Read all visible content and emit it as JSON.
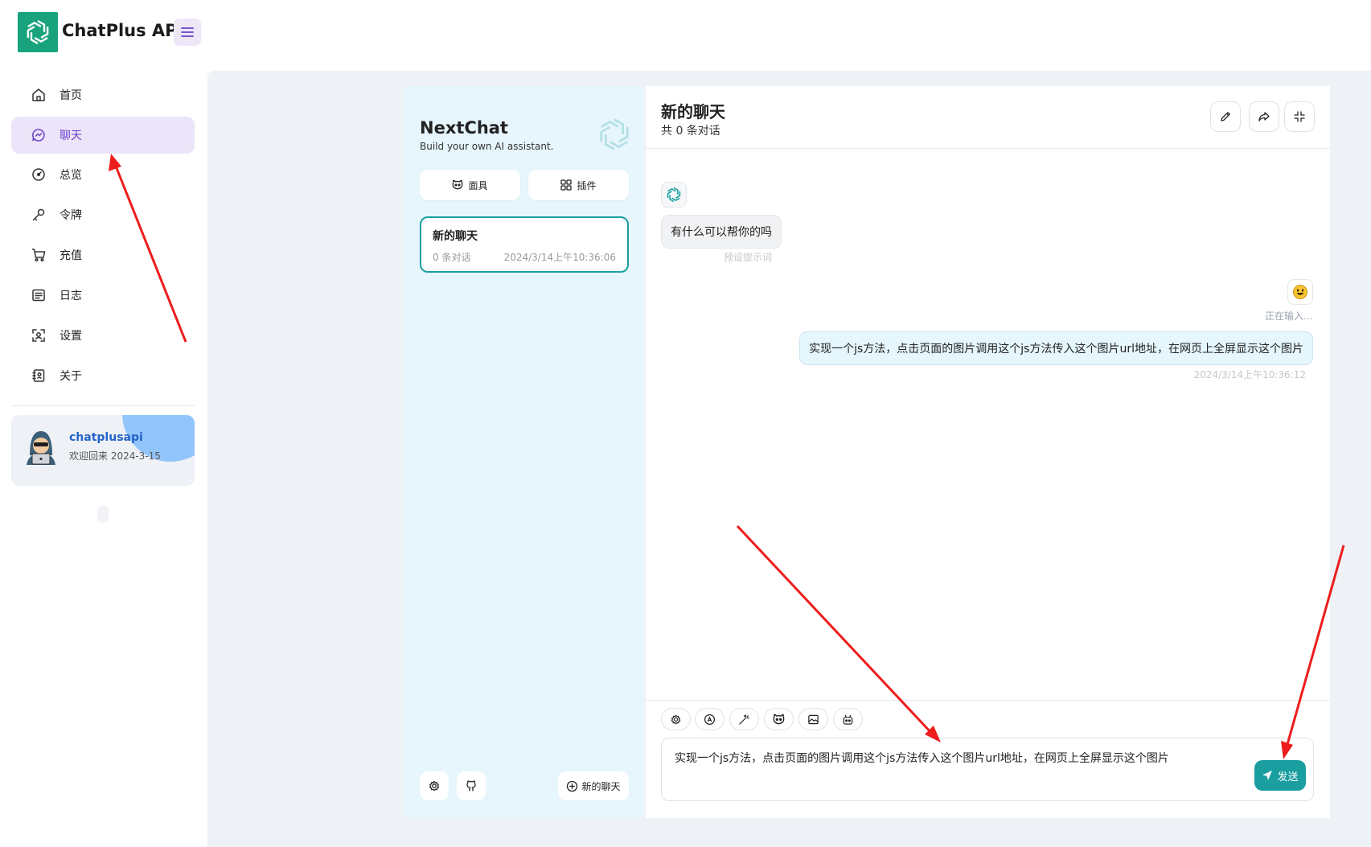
{
  "app": {
    "title": "ChatPlus API"
  },
  "colors": {
    "accent": "#1a9ea0",
    "brand": "#19a37c",
    "nav_active": "#ece4f8",
    "nav_active_text": "#6a3fc8",
    "annotation_arrow": "#ee1c1c"
  },
  "sidebar": {
    "items": [
      {
        "label": "首页",
        "icon": "home-icon",
        "active": false
      },
      {
        "label": "聊天",
        "icon": "chat-icon",
        "active": true
      },
      {
        "label": "总览",
        "icon": "dashboard-icon",
        "active": false
      },
      {
        "label": "令牌",
        "icon": "key-icon",
        "active": false
      },
      {
        "label": "充值",
        "icon": "cart-icon",
        "active": false
      },
      {
        "label": "日志",
        "icon": "log-icon",
        "active": false
      },
      {
        "label": "设置",
        "icon": "settings-icon",
        "active": false
      },
      {
        "label": "关于",
        "icon": "about-icon",
        "active": false
      }
    ]
  },
  "user": {
    "name": "chatplusapi",
    "welcome": "欢迎回来 2024-3-15"
  },
  "nextchat": {
    "title": "NextChat",
    "subtitle": "Build your own AI assistant.",
    "mask_label": "面具",
    "plugin_label": "插件",
    "new_chat_label": "新的聊天",
    "sessions": [
      {
        "title": "新的聊天",
        "count": "0 条对话",
        "time": "2024/3/14上午10:36:06"
      }
    ]
  },
  "chat": {
    "title": "新的聊天",
    "subtitle": "共 0 条对话",
    "messages": [
      {
        "role": "assistant",
        "text": "有什么可以帮你的吗",
        "meta": "预设提示词"
      },
      {
        "role": "user",
        "status": "正在输入…",
        "text": "实现一个js方法，点击页面的图片调用这个js方法传入这个图片url地址，在网页上全屏显示这个图片",
        "meta": "2024/3/14上午10:36:12"
      }
    ],
    "input_value": "实现一个js方法，点击页面的图片调用这个js方法传入这个图片url地址，在网页上全屏显示这个图片",
    "send_label": "发送"
  }
}
